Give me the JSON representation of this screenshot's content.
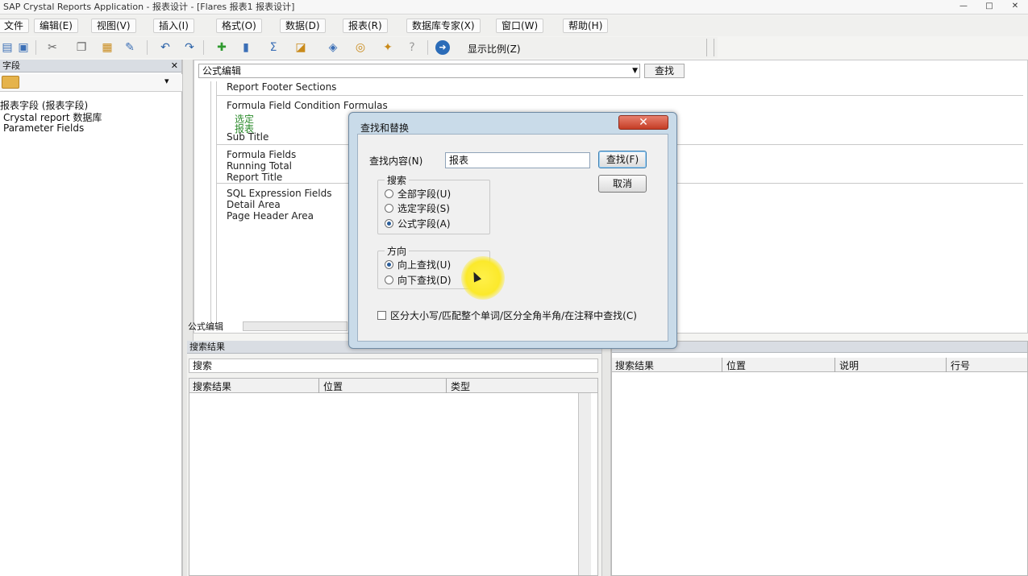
{
  "window": {
    "title": "SAP Crystal Reports Application - 报表设计 - [Flares 报表1 报表设计]",
    "min_label": "—",
    "max_label": "□",
    "close_label": "✕"
  },
  "menubar": {
    "items": [
      "文件",
      "编辑(E)",
      "视图(V)",
      "插入(I)",
      "格式(O)",
      "数据(D)",
      "报表(R)",
      "窗口(W)",
      "帮助(H)",
      "数据库专家(X)",
      "窗口(W)",
      "帮助(H)"
    ]
  },
  "toolbar": {
    "icons": [
      "new-icon",
      "save-icon",
      "cut-icon",
      "copy-icon",
      "paste-icon",
      "format-painter-icon",
      "undo-icon",
      "redo-icon",
      "insert-field-icon",
      "insert-group-icon",
      "insert-summary-icon",
      "chart-icon",
      "map-icon",
      "database-icon",
      "refresh-icon",
      "help-icon"
    ],
    "zoom_label": "显示比例(Z)"
  },
  "left_panel": {
    "header": "字段",
    "tree": [
      "报表字段 (报表字段)",
      "Crystal report 数据库",
      "Parameter Fields"
    ]
  },
  "editor": {
    "combo_value": "公式编辑",
    "find_button": "查找",
    "lines": [
      "Report Footer Sections",
      "Formula Field Condition Formulas",
      "选定",
      "报表",
      "Sub Title",
      "Formula Fields",
      "Running Total",
      "Report Title",
      "SQL Expression Fields",
      "Detail Area",
      "Page Header Area"
    ],
    "status_label": "公式编辑"
  },
  "bottom_left": {
    "title": "搜索结果",
    "search_label": "搜索",
    "columns": [
      "搜索结果",
      "位置",
      "类型"
    ]
  },
  "bottom_right": {
    "columns": [
      "搜索结果",
      "位置",
      "说明",
      "行号"
    ]
  },
  "dialog": {
    "title": "查找和替换",
    "find_label": "查找内容(N)",
    "find_value": "报表",
    "find_next_button": "查找(F)",
    "cancel_button": "取消",
    "group_search": {
      "title": "搜索",
      "options": [
        "全部字段(U)",
        "选定字段(S)",
        "公式字段(A)"
      ],
      "selected_index": 2
    },
    "group_direction": {
      "title": "方向",
      "options": [
        "向上查找(U)",
        "向下查找(D)"
      ],
      "selected_index": 0
    },
    "match_case_label": "区分大小写/匹配整个单词/区分全角半角/在注释中查找(C)"
  }
}
